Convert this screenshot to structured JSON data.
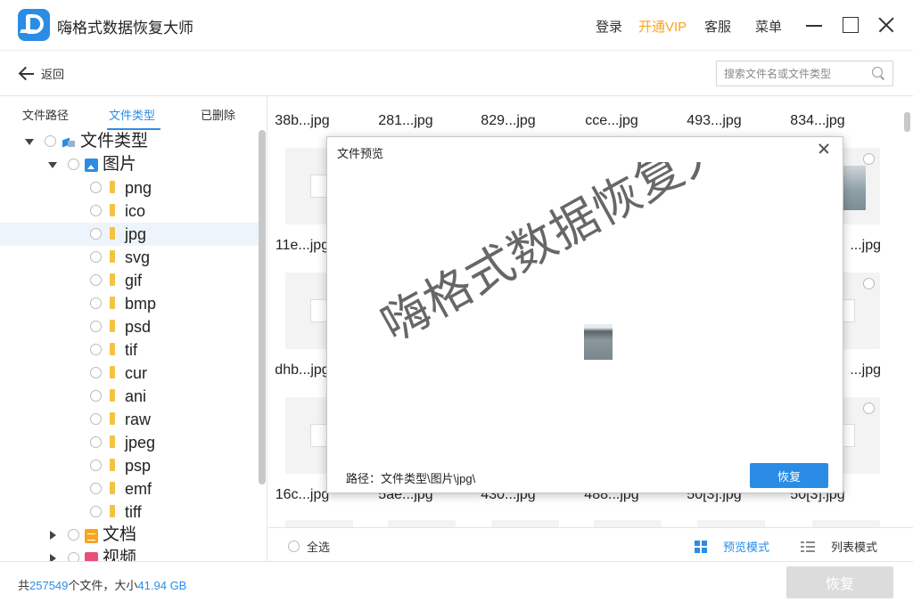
{
  "app": {
    "title": "嗨格式数据恢复大师",
    "nav": {
      "login": "登录",
      "vip": "开通VIP",
      "service": "客服",
      "menu": "菜单"
    },
    "vip_color": "#f5a623",
    "accent_color": "#2b8ce6"
  },
  "toolbar": {
    "back_label": "返回",
    "search_placeholder": "搜索文件名或文件类型"
  },
  "tabs": [
    {
      "label": "文件路径",
      "active": false
    },
    {
      "label": "文件类型",
      "active": true
    },
    {
      "label": "已删除",
      "active": false
    }
  ],
  "tree": {
    "root": "文件类型",
    "images": "图片",
    "extensions": [
      "png",
      "ico",
      "jpg",
      "svg",
      "gif",
      "bmp",
      "psd",
      "tif",
      "cur",
      "ani",
      "raw",
      "jpeg",
      "psp",
      "emf",
      "tiff"
    ],
    "selected_extension": "jpg",
    "documents": "文档",
    "video": "视频"
  },
  "grid": {
    "rows": [
      [
        "38b...jpg",
        "281...jpg",
        "829...jpg",
        "cce...jpg",
        "493...jpg",
        "834...jpg"
      ],
      [
        "11e...jpg",
        "",
        "",
        "",
        "",
        "...jpg"
      ],
      [
        "dhb...jpg",
        "",
        "",
        "",
        "",
        "...jpg"
      ],
      [
        "16c...jpg",
        "5ae...jpg",
        "430...jpg",
        "488...jpg",
        "50[3].jpg",
        "50[3].jpg"
      ]
    ]
  },
  "footer": {
    "select_all": "全选",
    "preview_mode": "预览模式",
    "list_mode": "列表模式"
  },
  "status": {
    "prefix": "共",
    "file_count": "257549",
    "middle": "个文件，大小",
    "size": "41.94 GB",
    "recover_label": "恢复"
  },
  "dialog": {
    "title": "文件预览",
    "watermark": "嗨格式数据恢复大师",
    "path": "路径：文件类型\\图片\\jpg\\",
    "recover_label": "恢复"
  }
}
